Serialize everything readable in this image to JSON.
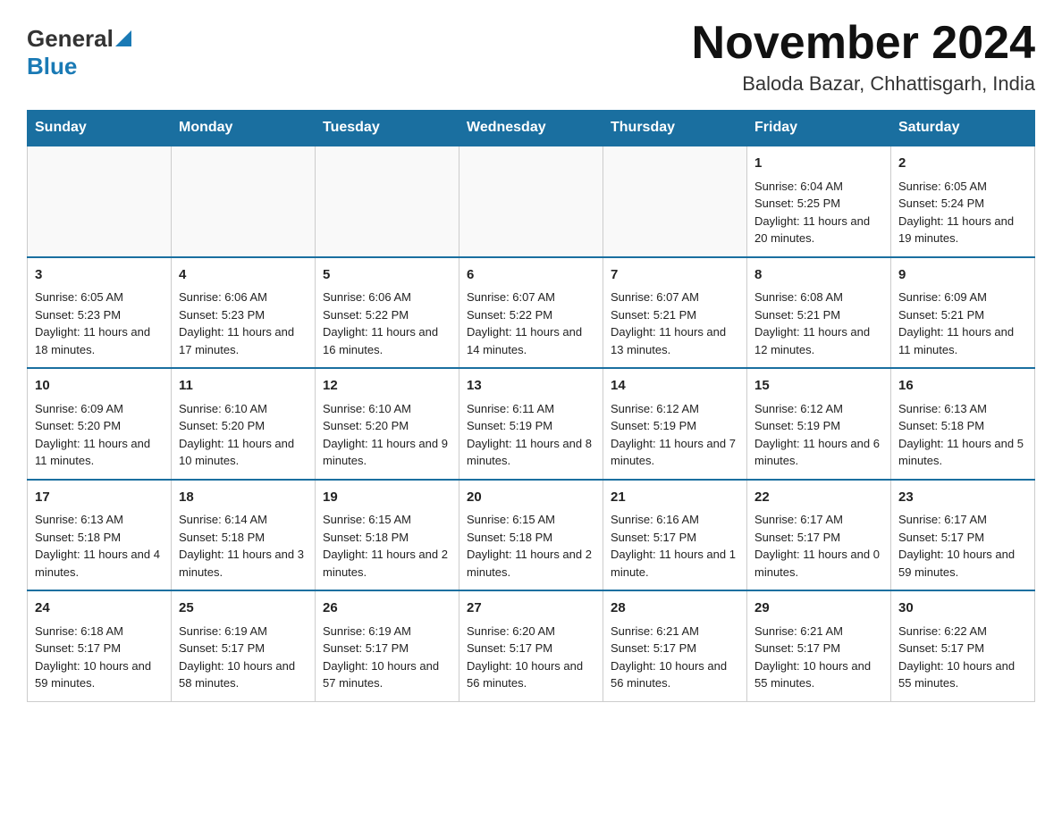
{
  "header": {
    "logo_general": "General",
    "logo_blue": "Blue",
    "title": "November 2024",
    "subtitle": "Baloda Bazar, Chhattisgarh, India"
  },
  "calendar": {
    "days": [
      "Sunday",
      "Monday",
      "Tuesday",
      "Wednesday",
      "Thursday",
      "Friday",
      "Saturday"
    ],
    "weeks": [
      [
        {
          "day": "",
          "info": ""
        },
        {
          "day": "",
          "info": ""
        },
        {
          "day": "",
          "info": ""
        },
        {
          "day": "",
          "info": ""
        },
        {
          "day": "",
          "info": ""
        },
        {
          "day": "1",
          "info": "Sunrise: 6:04 AM\nSunset: 5:25 PM\nDaylight: 11 hours and 20 minutes."
        },
        {
          "day": "2",
          "info": "Sunrise: 6:05 AM\nSunset: 5:24 PM\nDaylight: 11 hours and 19 minutes."
        }
      ],
      [
        {
          "day": "3",
          "info": "Sunrise: 6:05 AM\nSunset: 5:23 PM\nDaylight: 11 hours and 18 minutes."
        },
        {
          "day": "4",
          "info": "Sunrise: 6:06 AM\nSunset: 5:23 PM\nDaylight: 11 hours and 17 minutes."
        },
        {
          "day": "5",
          "info": "Sunrise: 6:06 AM\nSunset: 5:22 PM\nDaylight: 11 hours and 16 minutes."
        },
        {
          "day": "6",
          "info": "Sunrise: 6:07 AM\nSunset: 5:22 PM\nDaylight: 11 hours and 14 minutes."
        },
        {
          "day": "7",
          "info": "Sunrise: 6:07 AM\nSunset: 5:21 PM\nDaylight: 11 hours and 13 minutes."
        },
        {
          "day": "8",
          "info": "Sunrise: 6:08 AM\nSunset: 5:21 PM\nDaylight: 11 hours and 12 minutes."
        },
        {
          "day": "9",
          "info": "Sunrise: 6:09 AM\nSunset: 5:21 PM\nDaylight: 11 hours and 11 minutes."
        }
      ],
      [
        {
          "day": "10",
          "info": "Sunrise: 6:09 AM\nSunset: 5:20 PM\nDaylight: 11 hours and 11 minutes."
        },
        {
          "day": "11",
          "info": "Sunrise: 6:10 AM\nSunset: 5:20 PM\nDaylight: 11 hours and 10 minutes."
        },
        {
          "day": "12",
          "info": "Sunrise: 6:10 AM\nSunset: 5:20 PM\nDaylight: 11 hours and 9 minutes."
        },
        {
          "day": "13",
          "info": "Sunrise: 6:11 AM\nSunset: 5:19 PM\nDaylight: 11 hours and 8 minutes."
        },
        {
          "day": "14",
          "info": "Sunrise: 6:12 AM\nSunset: 5:19 PM\nDaylight: 11 hours and 7 minutes."
        },
        {
          "day": "15",
          "info": "Sunrise: 6:12 AM\nSunset: 5:19 PM\nDaylight: 11 hours and 6 minutes."
        },
        {
          "day": "16",
          "info": "Sunrise: 6:13 AM\nSunset: 5:18 PM\nDaylight: 11 hours and 5 minutes."
        }
      ],
      [
        {
          "day": "17",
          "info": "Sunrise: 6:13 AM\nSunset: 5:18 PM\nDaylight: 11 hours and 4 minutes."
        },
        {
          "day": "18",
          "info": "Sunrise: 6:14 AM\nSunset: 5:18 PM\nDaylight: 11 hours and 3 minutes."
        },
        {
          "day": "19",
          "info": "Sunrise: 6:15 AM\nSunset: 5:18 PM\nDaylight: 11 hours and 2 minutes."
        },
        {
          "day": "20",
          "info": "Sunrise: 6:15 AM\nSunset: 5:18 PM\nDaylight: 11 hours and 2 minutes."
        },
        {
          "day": "21",
          "info": "Sunrise: 6:16 AM\nSunset: 5:17 PM\nDaylight: 11 hours and 1 minute."
        },
        {
          "day": "22",
          "info": "Sunrise: 6:17 AM\nSunset: 5:17 PM\nDaylight: 11 hours and 0 minutes."
        },
        {
          "day": "23",
          "info": "Sunrise: 6:17 AM\nSunset: 5:17 PM\nDaylight: 10 hours and 59 minutes."
        }
      ],
      [
        {
          "day": "24",
          "info": "Sunrise: 6:18 AM\nSunset: 5:17 PM\nDaylight: 10 hours and 59 minutes."
        },
        {
          "day": "25",
          "info": "Sunrise: 6:19 AM\nSunset: 5:17 PM\nDaylight: 10 hours and 58 minutes."
        },
        {
          "day": "26",
          "info": "Sunrise: 6:19 AM\nSunset: 5:17 PM\nDaylight: 10 hours and 57 minutes."
        },
        {
          "day": "27",
          "info": "Sunrise: 6:20 AM\nSunset: 5:17 PM\nDaylight: 10 hours and 56 minutes."
        },
        {
          "day": "28",
          "info": "Sunrise: 6:21 AM\nSunset: 5:17 PM\nDaylight: 10 hours and 56 minutes."
        },
        {
          "day": "29",
          "info": "Sunrise: 6:21 AM\nSunset: 5:17 PM\nDaylight: 10 hours and 55 minutes."
        },
        {
          "day": "30",
          "info": "Sunrise: 6:22 AM\nSunset: 5:17 PM\nDaylight: 10 hours and 55 minutes."
        }
      ]
    ]
  }
}
